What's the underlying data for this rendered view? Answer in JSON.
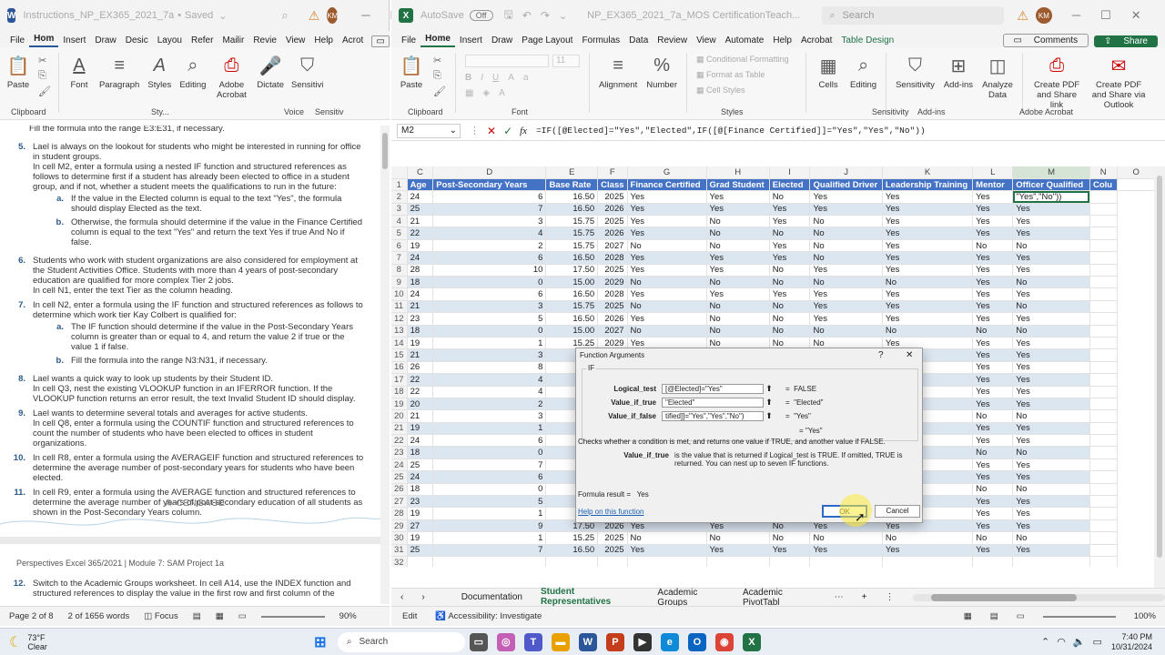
{
  "word": {
    "title": "Instructions_NP_EX365_2021_7a",
    "save_state": "Saved",
    "avatar": "KM",
    "tabs": [
      "File",
      "Hom",
      "Insert",
      "Draw",
      "Desic",
      "Layou",
      "Refer",
      "Mailir",
      "Revie",
      "View",
      "Help",
      "Acrot"
    ],
    "ribbon": {
      "paste": "Paste",
      "font": "Font",
      "paragraph": "Paragraph",
      "styles": "Styles",
      "editing": "Editing",
      "adobe": "Adobe Acrobat",
      "dictate": "Dictate",
      "sensitivity": "Sensitivi",
      "group_clipboard": "Clipboard",
      "group_styles": "Sty...",
      "group_voice": "Voice",
      "group_sensitivity": "Sensitiv"
    },
    "doc_partial_top": "Fill the formula into the range E3:E31, if necessary.",
    "items": [
      {
        "n": "5.",
        "text": "Lael is always on the lookout for students who might be interested in running for office in student groups.",
        "sub_text": "In cell M2, enter a formula using a nested IF function and structured references as follows to determine first if a student has already been elected to office in a student group, and if not, whether a student meets the qualifications to run in the future:"
      },
      {
        "n": "6.",
        "text": "Students who work with student organizations are also considered for employment at the Student Activities Office. Students with more than 4 years of post-secondary education are qualified for more complex Tier 2 jobs.",
        "sub_text": "In cell N1, enter the text Tier as the column heading."
      },
      {
        "n": "7.",
        "text": "In cell N2, enter a formula using the IF function and structured references as follows to determine which work tier Kay Colbert is qualified for:",
        "sub_text": ""
      },
      {
        "n": "8.",
        "text": "Lael wants a quick way to look up students by their Student ID.",
        "sub_text": "In cell Q3, nest the existing VLOOKUP function in an IFERROR function. If the VLOOKUP function returns an error result, the text Invalid Student ID should display."
      },
      {
        "n": "9.",
        "text": "Lael wants to determine several totals and averages for active students.",
        "sub_text": "In cell Q8, enter a formula using the COUNTIF function and structured references to count the number of students who have been elected to offices in student organizations."
      },
      {
        "n": "10.",
        "text": "In cell R8, enter a formula using the AVERAGEIF function and structured references to determine the average number of post-secondary years for students who have been elected.",
        "sub_text": ""
      },
      {
        "n": "11.",
        "text": "In cell R9, enter a formula using the AVERAGE function and structured references to determine the average number of years of post-secondary education of all students as shown in the Post-Secondary Years column.",
        "sub_text": ""
      }
    ],
    "item5_subs": [
      {
        "n": "a.",
        "text": "If the value in the Elected column is equal to the text \"Yes\", the formula should display Elected as the text."
      },
      {
        "n": "b.",
        "text": "Otherwise, the formula should determine if the value in the Finance Certified column is equal to the text \"Yes\" and return the text Yes if true And No if false."
      }
    ],
    "item7_subs": [
      {
        "n": "a.",
        "text": "The IF function should determine if the value in the Post-Secondary Years column is greater than or equal to 4, and return the value 2 if true or the value 1 if false."
      },
      {
        "n": "b.",
        "text": "Fill the formula into the range N3:N31, if necessary."
      }
    ],
    "cengage": "CENGAGE",
    "footer_header": "Perspectives Excel 365/2021 | Module 7: SAM Project 1a",
    "item12": {
      "n": "12.",
      "text": "Switch to the Academic Groups worksheet. In cell A14, use the INDEX function and structured references to display the value in the first row and first column of the"
    },
    "status": {
      "page": "Page 2 of 8",
      "words": "2 of 1656 words",
      "focus": "Focus",
      "zoom": "90%"
    }
  },
  "excel": {
    "autosave": "AutoSave",
    "autosave_state": "Off",
    "title": "NP_EX365_2021_7a_MOS CertificationTeach...",
    "search_placeholder": "Search",
    "avatar": "KM",
    "tabs": [
      "File",
      "Home",
      "Insert",
      "Draw",
      "Page Layout",
      "Formulas",
      "Data",
      "Review",
      "View",
      "Automate",
      "Help",
      "Acrobat",
      "Table Design"
    ],
    "comments": "Comments",
    "share": "Share",
    "ribbon": {
      "paste": "Paste",
      "font_name": "",
      "font_size": "11",
      "alignment": "Alignment",
      "number": "Number",
      "cond_format": "Conditional Formatting",
      "format_table": "Format as Table",
      "cell_styles": "Cell Styles",
      "cells": "Cells",
      "editing": "Editing",
      "sensitivity": "Sensitivity",
      "addins": "Add-ins",
      "analyze": "Analyze Data",
      "create_pdf": "Create PDF and Share link",
      "create_pdf_outlook": "Create PDF and Share via Outlook",
      "g_clipboard": "Clipboard",
      "g_font": "Font",
      "g_styles": "Styles",
      "g_sensitivity": "Sensitivity",
      "g_addins": "Add-ins",
      "g_acrobat": "Adobe Acrobat"
    },
    "name_box": "M2",
    "formula": "=IF([@Elected]=\"Yes\",\"Elected\",IF([@[Finance Certified]]=\"Yes\",\"Yes\",\"No\"))",
    "col_letters": [
      "C",
      "D",
      "E",
      "F",
      "G",
      "H",
      "I",
      "J",
      "K",
      "L",
      "M",
      "N",
      "O"
    ],
    "headers": [
      "Age",
      "Post-Secondary Years",
      "Base Rate",
      "Class",
      "Finance Certified",
      "Grad Student",
      "Elected",
      "Qualified Driver",
      "Leadership Training",
      "Mentor",
      "Officer Qualified",
      "Colu"
    ],
    "active_cell_text": "\"Yes\",\"No\"))",
    "rows": [
      [
        "2",
        "24",
        "6",
        "16.50",
        "2025",
        "Yes",
        "Yes",
        "No",
        "Yes",
        "Yes",
        "Yes",
        ""
      ],
      [
        "3",
        "25",
        "7",
        "16.50",
        "2026",
        "Yes",
        "Yes",
        "Yes",
        "Yes",
        "Yes",
        "Yes",
        "Yes"
      ],
      [
        "4",
        "21",
        "3",
        "15.75",
        "2025",
        "Yes",
        "No",
        "Yes",
        "No",
        "Yes",
        "Yes",
        "Yes"
      ],
      [
        "5",
        "22",
        "4",
        "15.75",
        "2026",
        "Yes",
        "No",
        "No",
        "No",
        "Yes",
        "Yes",
        "Yes"
      ],
      [
        "6",
        "19",
        "2",
        "15.75",
        "2027",
        "No",
        "No",
        "Yes",
        "No",
        "Yes",
        "No",
        "No"
      ],
      [
        "7",
        "24",
        "6",
        "16.50",
        "2028",
        "Yes",
        "Yes",
        "Yes",
        "No",
        "Yes",
        "Yes",
        "Yes"
      ],
      [
        "8",
        "28",
        "10",
        "17.50",
        "2025",
        "Yes",
        "Yes",
        "No",
        "Yes",
        "Yes",
        "Yes",
        "Yes"
      ],
      [
        "9",
        "18",
        "0",
        "15.00",
        "2029",
        "No",
        "No",
        "No",
        "No",
        "No",
        "Yes",
        "No"
      ],
      [
        "10",
        "24",
        "6",
        "16.50",
        "2028",
        "Yes",
        "Yes",
        "Yes",
        "Yes",
        "Yes",
        "Yes",
        "Yes"
      ],
      [
        "11",
        "21",
        "3",
        "15.75",
        "2025",
        "No",
        "No",
        "No",
        "Yes",
        "Yes",
        "Yes",
        "No"
      ],
      [
        "12",
        "23",
        "5",
        "16.50",
        "2026",
        "Yes",
        "No",
        "No",
        "Yes",
        "Yes",
        "Yes",
        "Yes"
      ],
      [
        "13",
        "18",
        "0",
        "15.00",
        "2027",
        "No",
        "No",
        "No",
        "No",
        "No",
        "No",
        "No"
      ],
      [
        "14",
        "19",
        "1",
        "15.25",
        "2029",
        "Yes",
        "No",
        "No",
        "No",
        "Yes",
        "Yes",
        "Yes"
      ],
      [
        "15",
        "21",
        "3",
        "15.7",
        "",
        "",
        "",
        "",
        "",
        "",
        "Yes",
        "Yes"
      ],
      [
        "16",
        "26",
        "8",
        "17.5",
        "",
        "",
        "",
        "",
        "",
        "",
        "Yes",
        "Yes"
      ],
      [
        "17",
        "22",
        "4",
        "15.7",
        "",
        "",
        "",
        "",
        "",
        "",
        "Yes",
        "Yes"
      ],
      [
        "18",
        "22",
        "4",
        "15.7",
        "",
        "",
        "",
        "",
        "",
        "",
        "Yes",
        "Yes"
      ],
      [
        "19",
        "20",
        "2",
        "15.7",
        "",
        "",
        "",
        "",
        "",
        "",
        "Yes",
        "Yes"
      ],
      [
        "20",
        "21",
        "3",
        "15.7",
        "",
        "",
        "",
        "",
        "",
        "",
        "No",
        "No"
      ],
      [
        "21",
        "19",
        "1",
        "15.2",
        "",
        "",
        "",
        "",
        "",
        "",
        "Yes",
        "Yes"
      ],
      [
        "22",
        "24",
        "6",
        "16.5",
        "",
        "",
        "",
        "",
        "",
        "",
        "Yes",
        "Yes"
      ],
      [
        "23",
        "18",
        "0",
        "15.0",
        "",
        "",
        "",
        "",
        "",
        "",
        "No",
        "No"
      ],
      [
        "24",
        "25",
        "7",
        "16.5",
        "",
        "",
        "",
        "",
        "",
        "",
        "Yes",
        "Yes"
      ],
      [
        "25",
        "24",
        "6",
        "16.5",
        "",
        "",
        "",
        "",
        "",
        "",
        "Yes",
        "Yes"
      ],
      [
        "26",
        "18",
        "0",
        "15.0",
        "",
        "",
        "",
        "",
        "",
        "",
        "No",
        "No"
      ],
      [
        "27",
        "23",
        "5",
        "16.5",
        "",
        "",
        "",
        "",
        "",
        "",
        "Yes",
        "Yes"
      ],
      [
        "28",
        "19",
        "1",
        "15.2",
        "",
        "",
        "",
        "",
        "",
        "",
        "Yes",
        "Yes"
      ],
      [
        "29",
        "27",
        "9",
        "17.50",
        "2026",
        "Yes",
        "Yes",
        "No",
        "Yes",
        "Yes",
        "Yes",
        "Yes"
      ],
      [
        "30",
        "19",
        "1",
        "15.25",
        "2025",
        "No",
        "No",
        "No",
        "No",
        "No",
        "No",
        "No"
      ],
      [
        "31",
        "25",
        "7",
        "16.50",
        "2025",
        "Yes",
        "Yes",
        "Yes",
        "Yes",
        "Yes",
        "Yes",
        "Yes"
      ],
      [
        "32",
        "",
        "",
        "",
        "",
        "",
        "",
        "",
        "",
        "",
        "",
        ""
      ],
      [
        "33",
        "",
        "",
        "",
        "",
        "",
        "",
        "",
        "",
        "",
        "",
        ""
      ]
    ],
    "sheet_tabs": [
      "Documentation",
      "Student Representatives",
      "Academic Groups",
      "Academic PivotTabl"
    ],
    "active_sheet": "Student Representatives",
    "status": {
      "mode": "Edit",
      "accessibility": "Accessibility: Investigate",
      "zoom": "100%"
    }
  },
  "dialog": {
    "title": "Function Arguments",
    "func": "IF",
    "args": [
      {
        "label": "Logical_test",
        "value": "[@Elected]=\"Yes\"",
        "result": "FALSE"
      },
      {
        "label": "Value_if_true",
        "value": "\"Elected\"",
        "result": "\"Elected\""
      },
      {
        "label": "Value_if_false",
        "value": "tified]]=\"Yes\",\"Yes\",\"No\")",
        "result": "\"Yes\""
      }
    ],
    "overall_result": "= \"Yes\"",
    "description": "Checks whether a condition is met, and returns one value if TRUE, and another value if FALSE.",
    "arg_name": "Value_if_true",
    "arg_desc": "is the value that is returned if Logical_test is TRUE. If omitted, TRUE is returned. You can nest up to seven IF functions.",
    "formula_result_label": "Formula result =",
    "formula_result": "Yes",
    "help_link": "Help on this function",
    "ok": "OK",
    "cancel": "Cancel",
    "help_q": "?",
    "close": "✕"
  },
  "taskbar": {
    "temp": "73°F",
    "weather": "Clear",
    "search": "Search",
    "time": "7:40 PM",
    "date": "10/31/2024"
  },
  "colors": {
    "excel_green": "#217346",
    "word_blue": "#2b579a",
    "table_header": "#4472c4",
    "band": "#dce6f1"
  }
}
